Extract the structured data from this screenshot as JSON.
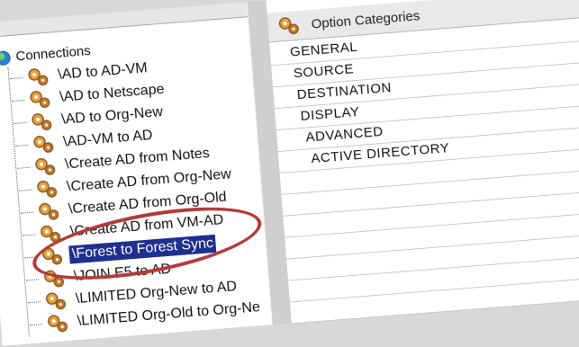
{
  "tree": {
    "root_label": "Connections",
    "items": [
      {
        "label": "\\AD to AD-VM",
        "icon": "gears-icon"
      },
      {
        "label": "\\AD to Netscape",
        "icon": "gears-icon"
      },
      {
        "label": "\\AD to Org-New",
        "icon": "gears-icon"
      },
      {
        "label": "\\AD-VM to AD",
        "icon": "gears-icon"
      },
      {
        "label": "\\Create AD from Notes",
        "icon": "gears-icon"
      },
      {
        "label": "\\Create AD from Org-New",
        "icon": "gears-icon"
      },
      {
        "label": "\\Create AD from Org-Old",
        "icon": "gears-icon"
      },
      {
        "label": "\\Create AD from VM-AD",
        "icon": "gears-icon"
      },
      {
        "label": "\\Forest to Forest Sync",
        "icon": "gears-icon",
        "selected": true
      },
      {
        "label": "\\JOIN E5 to AD",
        "icon": "gears-icon"
      },
      {
        "label": "\\LIMITED Org-New to AD",
        "icon": "gears-icon"
      },
      {
        "label": "\\LIMITED Org-Old to Org-Ne",
        "icon": "gears-icon"
      }
    ]
  },
  "options": {
    "header": "Option Categories",
    "items": [
      "GENERAL",
      "SOURCE",
      "DESTINATION",
      "DISPLAY",
      "ADVANCED",
      "ACTIVE DIRECTORY"
    ]
  },
  "colors": {
    "selection_bg": "#1f2f8f",
    "highlight_ring": "#b33a3a",
    "gear_orange": "#e8a03a",
    "gear_brown": "#8a5a2a"
  }
}
